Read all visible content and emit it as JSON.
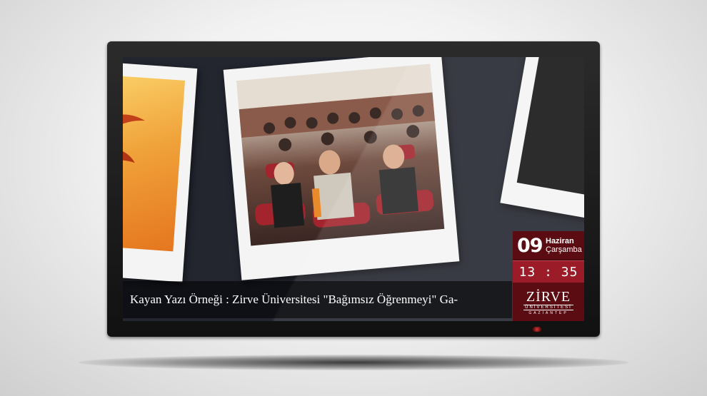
{
  "ticker": {
    "text": "Kayan Yazı Örneği : Zirve Üniversitesi \"Bağımsız Öğrenmeyi\" Ga-"
  },
  "info_panel": {
    "day": "09",
    "month": "Haziran",
    "weekday": "Çarşamba",
    "time": "13 : 35"
  },
  "logo": {
    "name": "ZİRVE",
    "sub": "ÜNİVERSİTESİ",
    "city": "GAZİANTEP"
  },
  "colors": {
    "accent_dark": "#5a0c12",
    "accent_red": "#9b1b28",
    "screen_bg": "#23252f"
  }
}
